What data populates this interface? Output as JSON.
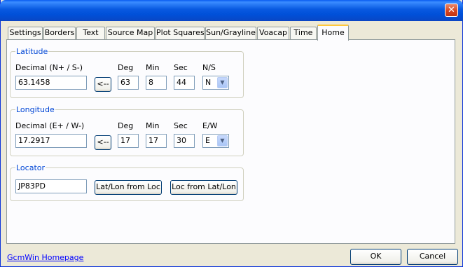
{
  "window": {
    "close_glyph": "✕"
  },
  "tabs": [
    "Settings",
    "Borders",
    "Text",
    "Source Map",
    "Plot Squares",
    "Sun/Grayline",
    "Voacap",
    "Time",
    "Home"
  ],
  "active_tab": "Home",
  "latitude": {
    "legend": "Latitude",
    "decimal_label": "Decimal (N+ / S-)",
    "decimal_value": "63.1458",
    "convert_button": "<--",
    "deg_label": "Deg",
    "deg_value": "63",
    "min_label": "Min",
    "min_value": "8",
    "sec_label": "Sec",
    "sec_value": "44",
    "hemi_label": "N/S",
    "hemi_value": "N"
  },
  "longitude": {
    "legend": "Longitude",
    "decimal_label": "Decimal (E+ / W-)",
    "decimal_value": "17.2917",
    "convert_button": "<--",
    "deg_label": "Deg",
    "deg_value": "17",
    "min_label": "Min",
    "min_value": "17",
    "sec_label": "Sec",
    "sec_value": "30",
    "hemi_label": "E/W",
    "hemi_value": "E"
  },
  "locator": {
    "legend": "Locator",
    "value": "JP83PD",
    "latlon_from_loc_button": "Lat/Lon from Loc",
    "loc_from_latlon_button": "Loc from Lat/Lon"
  },
  "footer": {
    "homepage_link": "GcmWin Homepage",
    "ok_button": "OK",
    "cancel_button": "Cancel"
  }
}
